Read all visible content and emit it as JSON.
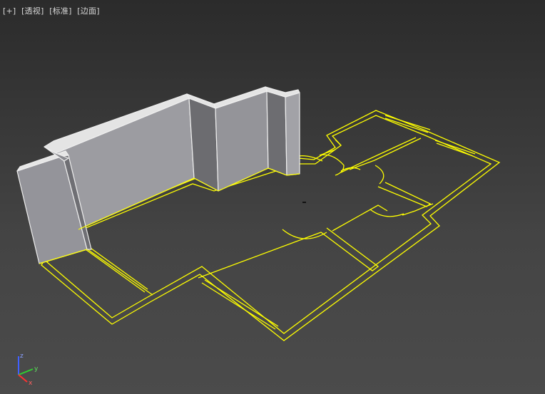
{
  "viewport": {
    "label_menu": "[+]",
    "label_view": "[透视]",
    "label_shading": "[标准]",
    "label_display": "[边面]",
    "background_top": "#2b2b2b",
    "background_bottom": "#4b4b4b",
    "selection_color": "#ffff00",
    "wall_color": "#a9a9ae"
  },
  "axis_gizmo": {
    "icon": "xyz-axis-gizmo-icon",
    "x_color": "#ff3030",
    "y_color": "#30d030",
    "z_color": "#4060ff",
    "x_label": "x",
    "y_label": "y",
    "z_label": "z"
  }
}
